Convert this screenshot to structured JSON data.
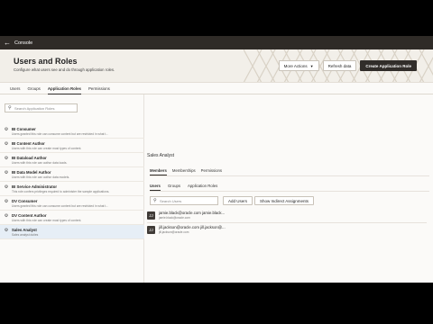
{
  "topbar": {
    "title": "Console"
  },
  "header": {
    "title": "Users and Roles",
    "subtitle": "Configure what users see and do through application roles.",
    "more_actions": "More Actions",
    "refresh": "Refresh data",
    "create_role": "Create Application Role"
  },
  "main_tabs": [
    "Users",
    "Groups",
    "Application Roles",
    "Permissions"
  ],
  "left": {
    "search_placeholder": "Search Application Roles",
    "roles": [
      {
        "name": "BI Consumer",
        "desc": "Users granted this role can consume content but are restricted in what t..."
      },
      {
        "name": "BI Content Author",
        "desc": "Users with this role can create most types of content."
      },
      {
        "name": "BI Dataload Author",
        "desc": "Users with this role can author data loads."
      },
      {
        "name": "BI Data Model Author",
        "desc": "Users with this role can author data models."
      },
      {
        "name": "BI Service Administrator",
        "desc": "This role confers privileges required to administer the sample applications."
      },
      {
        "name": "DV Consumer",
        "desc": "Users granted this role can consume content but are restricted in what t..."
      },
      {
        "name": "DV Content Author",
        "desc": "Users with this role can create most types of content."
      },
      {
        "name": "Sales Analyst",
        "desc": "Sales analyst duties"
      }
    ]
  },
  "right": {
    "role_title": "Sales Analyst",
    "sub_tabs": [
      "Members",
      "Memberships",
      "Permissions"
    ],
    "member_tabs": [
      "Users",
      "Groups",
      "Application Roles"
    ],
    "search_placeholder": "Search Users",
    "add_users": "Add Users",
    "show_indirect": "Show Indirect Assignments",
    "users": [
      {
        "initial": "JJ",
        "main": "jamie.black@oracle.com jamie.black...",
        "sub": "jamie.black@oracle.com"
      },
      {
        "initial": "JJ",
        "main": "jill.jackson@oracle.com jill.jackson@...",
        "sub": "jill.jackson@oracle.com"
      }
    ]
  },
  "colors": {
    "topbar": "#2f2b27",
    "primary_button": "#312d2a",
    "selected_row": "#e6eef6"
  }
}
